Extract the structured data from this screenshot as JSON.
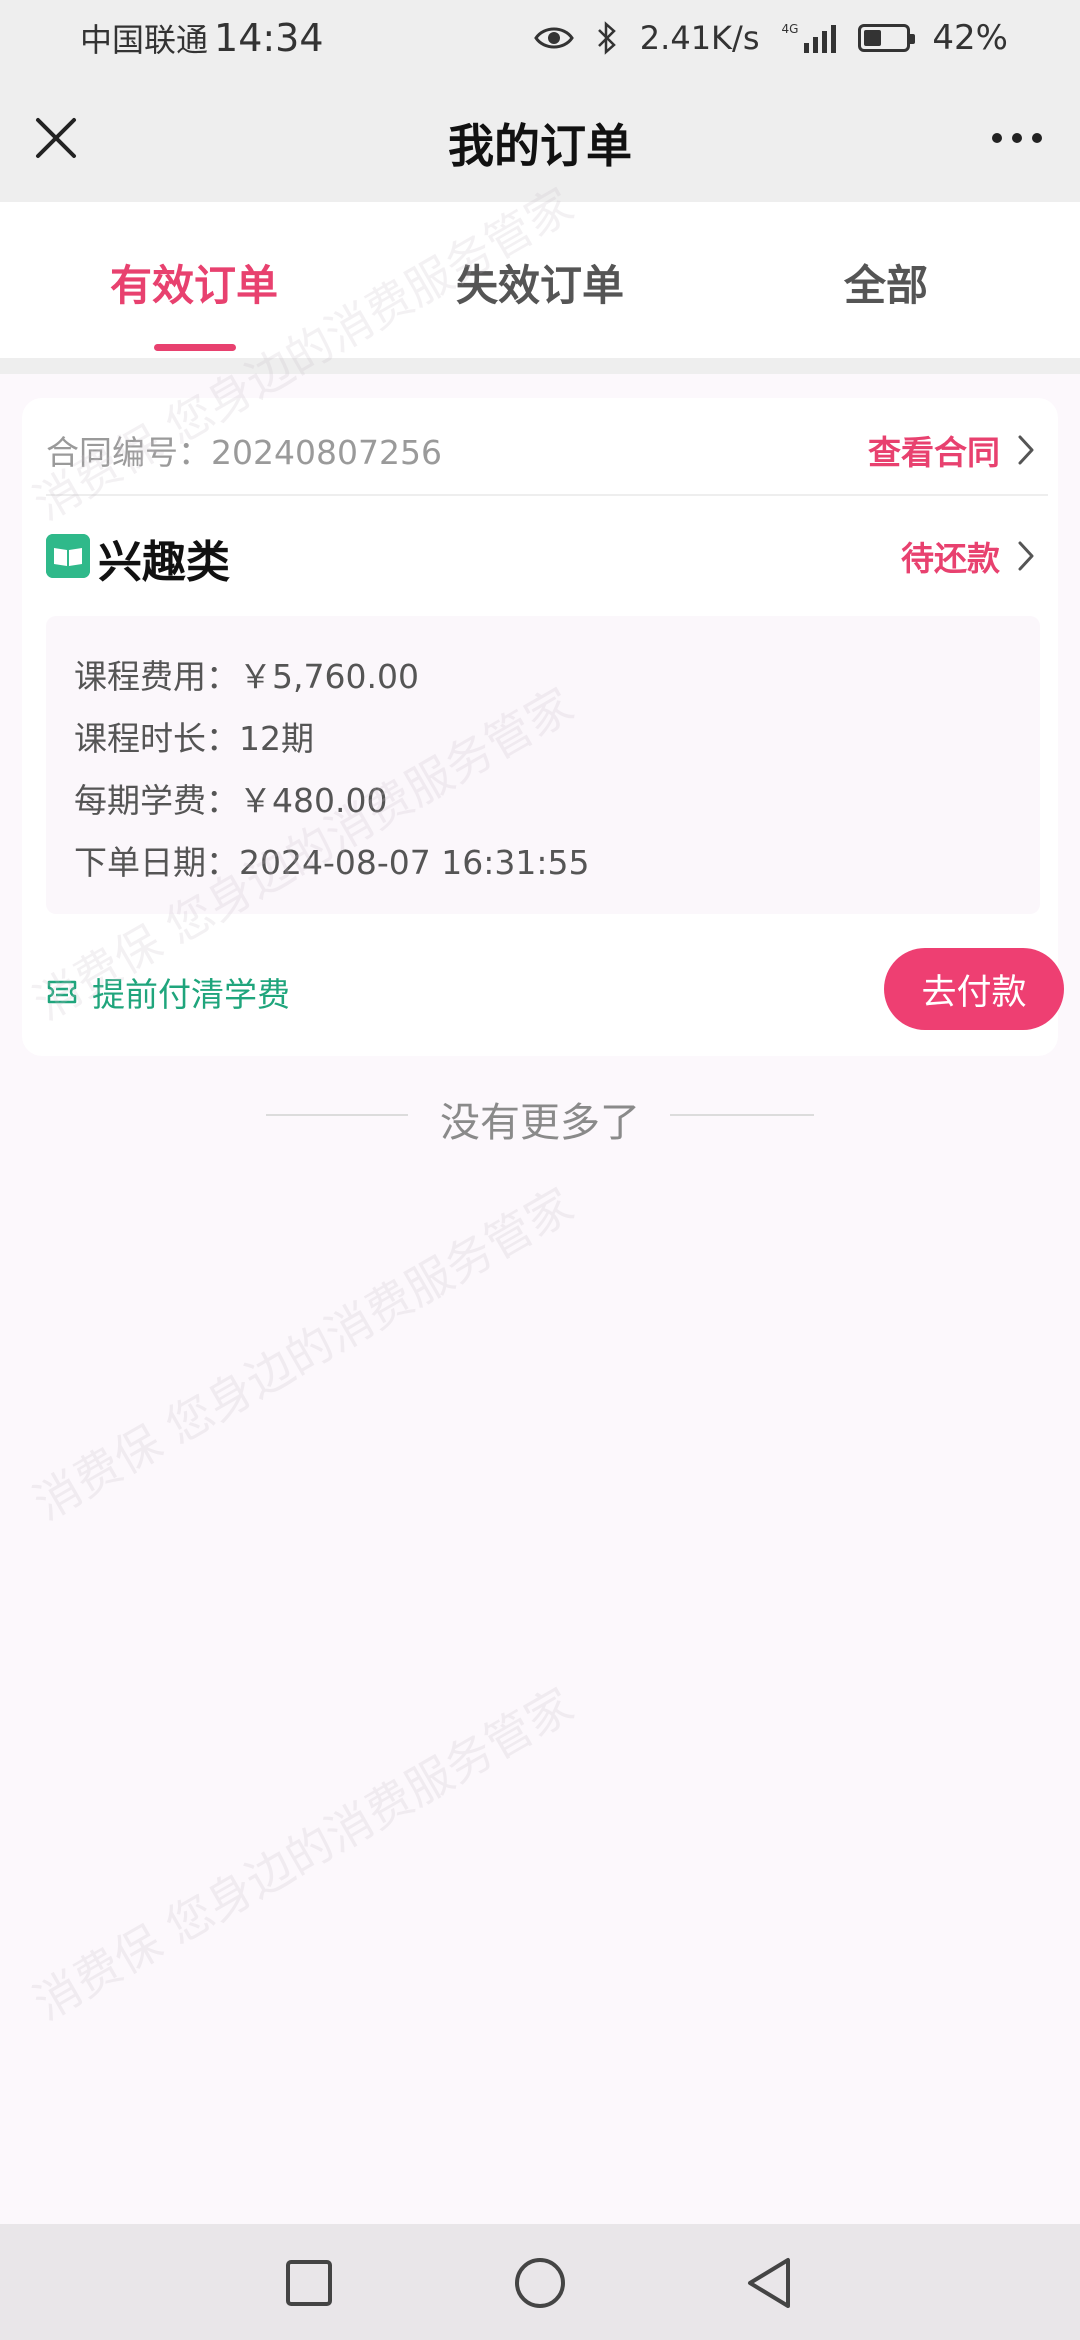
{
  "status_bar": {
    "carrier": "中国联通",
    "time": "14:34",
    "net_speed": "2.41K/s",
    "network_type": "4G",
    "battery": "42%",
    "battery_level": 0.42,
    "icons": [
      "eye-icon",
      "bluetooth-icon",
      "signal-icon",
      "battery-icon"
    ]
  },
  "nav": {
    "title": "我的订单",
    "left_icon": "close-icon",
    "right_icon": "more-icon"
  },
  "tabs": [
    {
      "label": "有效订单",
      "active": true
    },
    {
      "label": "失效订单",
      "active": false
    },
    {
      "label": "全部",
      "active": false
    }
  ],
  "order": {
    "contract_label": "合同编号：",
    "contract_number": "20240807256",
    "view_contract": "查看合同",
    "category_icon": "book-icon",
    "category": "兴趣类",
    "status": "待还款",
    "details": [
      "课程费用：￥5,760.00",
      "课程时长：12期",
      "每期学费：￥480.00",
      "下单日期：2024-08-07 16:31:55"
    ],
    "prepay_icon": "ticket-icon",
    "prepay_label": "提前付清学费",
    "pay_button": "去付款"
  },
  "list_end": "没有更多了",
  "watermark": "消费保 您身边的消费服务管家",
  "colors": {
    "accent": "#e8416f",
    "pay_button": "#ee3f72",
    "green": "#1fa57c",
    "category_icon_bg": "#2fb98a",
    "bar_bg": "#eeeeee",
    "page_bg": "#fcf8fc"
  },
  "system_nav": [
    "square-icon",
    "circle-icon",
    "triangle-back-icon"
  ]
}
